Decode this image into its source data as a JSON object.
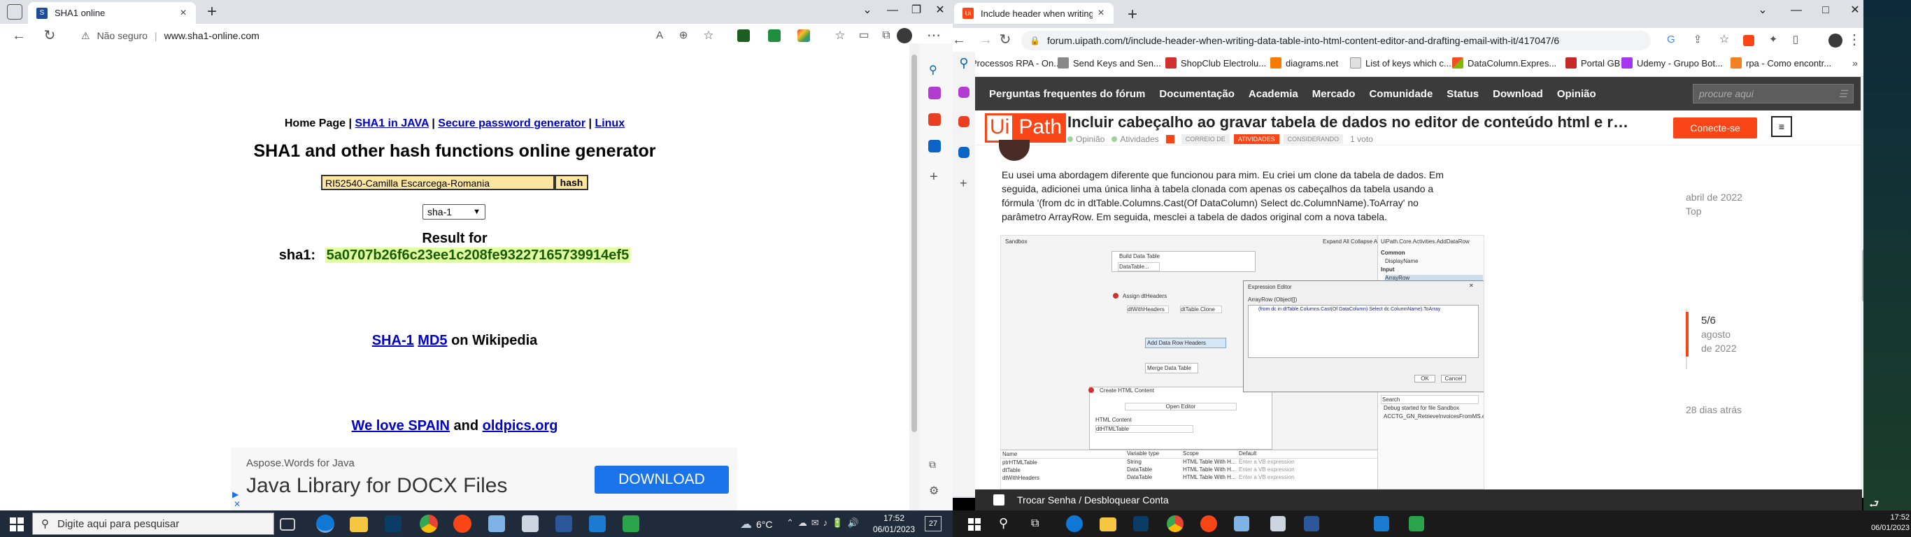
{
  "left_browser": {
    "tab_title": "SHA1 online",
    "security_label": "Não seguro",
    "url": "www.sha1-online.com",
    "page": {
      "nav": {
        "home": "Home Page",
        "sep": "|",
        "java": "SHA1 in JAVA",
        "pwgen": "Secure password generator",
        "linux": "Linux"
      },
      "heading": "SHA1 and other hash functions online generator",
      "input_value": "RI52540-Camilla Escarcega-Romania",
      "hash_button": "hash",
      "algorithm": "sha-1",
      "result_label": "Result for",
      "result_prefix": "sha1:",
      "result_hash": "5a0707b26f6c23ee1c208fe93227165739914ef5",
      "wiki": {
        "sha1": "SHA-1",
        "md5": "MD5",
        "on": "on Wikipedia"
      },
      "promo": {
        "spain": "We love SPAIN",
        "and": "and",
        "oldpics": "oldpics.org"
      },
      "ad": {
        "small": "Aspose.Words for Java",
        "big": "Java Library for DOCX Files",
        "button": "DOWNLOAD"
      }
    }
  },
  "right_browser": {
    "tab_title": "Include header when writing data",
    "url": "forum.uipath.com/t/include-header-when-writing-data-table-into-html-content-editor-and-drafting-email-with-it/417047/6",
    "bookmarks": [
      "Processos RPA - On...",
      "Send Keys and Sen...",
      "ShopClub Electrolu...",
      "diagrams.net",
      "List of keys which c...",
      "DataColumn.Expres...",
      "Portal GB",
      "Udemy - Grupo Bot...",
      "rpa - Como encontr..."
    ],
    "forum_nav": [
      "Perguntas frequentes do fórum",
      "Documentação",
      "Academia",
      "Mercado",
      "Comunidade",
      "Status",
      "Download",
      "Opinião"
    ],
    "search_placeholder": "procure aqui",
    "logo_ui": "Ui",
    "logo_path": "Path",
    "topic_title": "Incluir cabeçalho ao gravar tabela de dados no editor de conteúdo html e r…",
    "crumbs": {
      "opiniao": "Opinião",
      "atividades": "Atividades",
      "correio": "CORREIO DE",
      "tag_atividades": "ATIVIDADES",
      "tag_considerando": "CONSIDERANDO",
      "votes": "1 voto"
    },
    "connect_button": "Conecte-se",
    "post_text": "Eu usei uma abordagem diferente que funcionou para mim. Eu criei um clone da tabela de dados. Em seguida, adicionei uma única linha à tabela clonada com apenas os cabeçalhos da tabela usando a fórmula '(from dc in dtTable.Columns.Cast(Of DataColumn) Select dc.ColumnName).ToArray' no parâmetro ArrayRow. Em seguida, mesclei a tabela de dados original com a nova tabela.",
    "timeline": {
      "start_date": "abril de 2022",
      "top": "Top",
      "position": "5/6",
      "month": "agosto",
      "year": "de 2022",
      "ago": "28 dias atrás"
    },
    "timeline_progress": 0.83,
    "screenshot": {
      "sandbox": "Sandbox",
      "expand": "Expand All",
      "collapse": "Collapse All",
      "activity_path": "UiPath.Core.Activities.AddDataRow",
      "build": "Build Data Table",
      "datatable_btn": "DataTable...",
      "assign": "Assign dtHeaders",
      "assign_to": "dtWithHeaders",
      "assign_value": "dtTable.Clone",
      "add_row": "Add Data Row Headers",
      "merge": "Merge Data Table",
      "create_html": "Create HTML Content",
      "open_editor": "Open Editor",
      "html_content": "HTML Content",
      "html_var": "dtHTMLTable",
      "props_common": "Common",
      "props_display": "DisplayName",
      "props_input": "Input",
      "props_arrayrow": "ArrayRow",
      "expr_title": "Expression Editor",
      "expr_sub": "ArrayRow (Object[])",
      "expr_code": "(from dc in dtTable.Columns.Cast(Of DataColumn) Select dc.ColumnName).ToArray",
      "ok": "OK",
      "cancel": "Cancel",
      "search": "Search",
      "debug": "Debug started for file Sandbox",
      "debug2": "ACCTG_GN_RetrieveInvoicesFromMS.exce",
      "var_headers": [
        "Name",
        "Variable type",
        "Scope",
        "Default"
      ],
      "var_rows": [
        [
          "ptrHTMLTable",
          "String",
          "HTML Table With H...",
          "Enter a VB expression"
        ],
        [
          "dtTable",
          "DataTable",
          "HTML Table With H...",
          "Enter a VB expression"
        ],
        [
          "dtWithHeaders",
          "DataTable",
          "HTML Table With H...",
          "Enter a VB expression"
        ]
      ]
    },
    "bottom_bar": "Trocar Senha / Desbloquear Conta"
  },
  "taskbar": {
    "search_placeholder": "Digite aqui para pesquisar",
    "weather": "6°C",
    "time": "17:52",
    "date": "06/01/2023",
    "notif_count": "27",
    "right_time": "17:52",
    "right_date": "06/01/2023"
  }
}
